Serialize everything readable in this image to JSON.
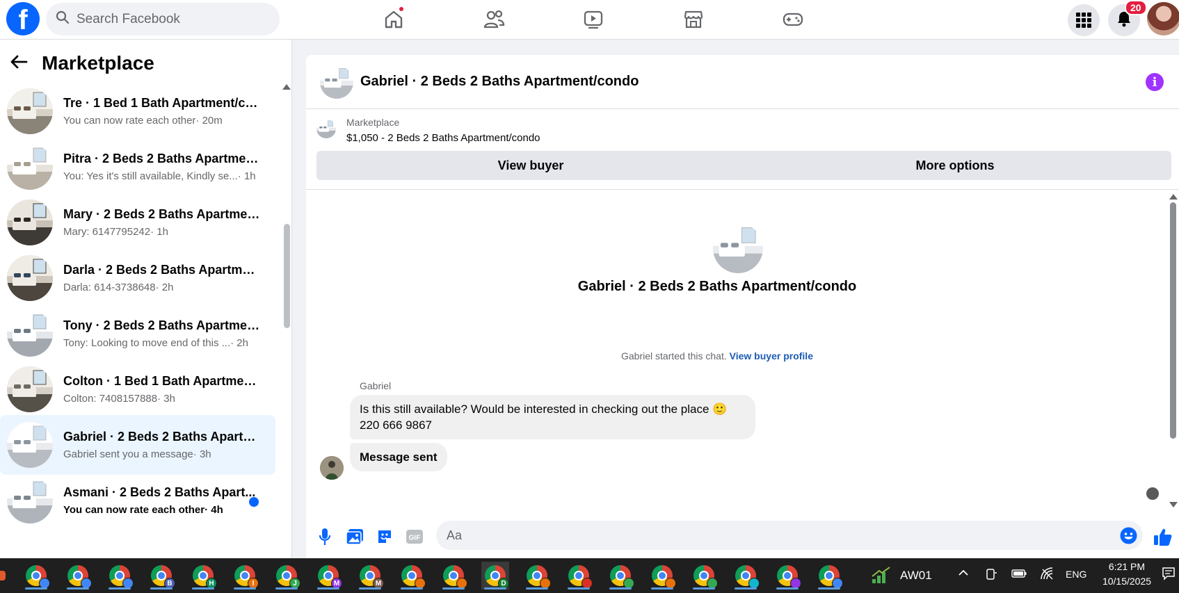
{
  "topbar": {
    "search_placeholder": "Search Facebook",
    "notification_count": "20",
    "icons": [
      "facebook-logo",
      "search-icon",
      "home-icon",
      "friends-icon",
      "video-icon",
      "marketplace-icon",
      "gaming-icon",
      "apps-grid-icon",
      "bell-icon",
      "profile-avatar"
    ]
  },
  "sidebar": {
    "title": "Marketplace",
    "conversations": [
      {
        "title": "Tre · 1 Bed 1 Bath Apartment/co...",
        "message": "You can now rate each other",
        "time": "· 20m",
        "unread": false,
        "selected": false
      },
      {
        "title": "Pitra · 2 Beds 2 Baths Apartment/...",
        "message": "You: Yes it's still available, Kindly se...",
        "time": " · 1h",
        "unread": false,
        "selected": false
      },
      {
        "title": "Mary · 2 Beds 2 Baths Apartmen...",
        "message": "Mary: 6147795242",
        "time": " · 1h",
        "unread": false,
        "selected": false
      },
      {
        "title": "Darla · 2 Beds 2 Baths Apartmen...",
        "message": "Darla: 614-3738648",
        "time": " · 2h",
        "unread": false,
        "selected": false
      },
      {
        "title": "Tony · 2 Beds 2 Baths Apartment...",
        "message": "Tony: Looking to move end of this ...",
        "time": " · 2h",
        "unread": false,
        "selected": false
      },
      {
        "title": "Colton · 1 Bed 1 Bath Apartment...",
        "message": "Colton: 7408157888",
        "time": " · 3h",
        "unread": false,
        "selected": false
      },
      {
        "title": "Gabriel · 2 Beds 2 Baths Apartm...",
        "message": "Gabriel sent you a message",
        "time": " · 3h",
        "unread": false,
        "selected": true
      },
      {
        "title": "Asmani · 2 Beds 2 Baths Apart...",
        "message": "You can now rate each other",
        "time": " · 4h",
        "unread": true,
        "selected": false
      }
    ]
  },
  "chat": {
    "header_title": "Gabriel · 2 Beds 2 Baths Apartment/condo",
    "listing_label": "Marketplace",
    "listing_price": "$1,050 - 2 Beds 2 Baths Apartment/condo",
    "view_buyer": "View buyer",
    "more_options": "More options",
    "center_title": "Gabriel · 2 Beds 2 Baths Apartment/condo",
    "started_text": "Gabriel started this chat.",
    "view_buyer_profile": "View buyer profile",
    "sender_name": "Gabriel",
    "message_line1": "Is this still available? Would be interested in checking out the place 🙂",
    "message_line2": "220 666 9867",
    "message_sent": "Message sent",
    "composer_placeholder": "Aa"
  },
  "taskbar": {
    "apps": [
      {
        "letter": "",
        "color": "#4285f4"
      },
      {
        "letter": "",
        "color": "#4285f4"
      },
      {
        "letter": "",
        "color": "#4285f4"
      },
      {
        "letter": "B",
        "color": "#4a5fb5"
      },
      {
        "letter": "H",
        "color": "#0a8f5f"
      },
      {
        "letter": "I",
        "color": "#e8710a"
      },
      {
        "letter": "J",
        "color": "#34a853"
      },
      {
        "letter": "M",
        "color": "#9334e6"
      },
      {
        "letter": "M",
        "color": "#7d5a50"
      },
      {
        "letter": "",
        "color": "#e8710a"
      },
      {
        "letter": "",
        "color": "#e8710a"
      },
      {
        "letter": "D",
        "color": "#188038"
      },
      {
        "letter": "",
        "color": "#e8710a"
      },
      {
        "letter": "",
        "color": "#d93025"
      },
      {
        "letter": "",
        "color": "#34a853"
      },
      {
        "letter": "",
        "color": "#e8710a"
      },
      {
        "letter": "",
        "color": "#34a853"
      },
      {
        "letter": "",
        "color": "#12b5cb"
      },
      {
        "letter": "",
        "color": "#9334e6"
      },
      {
        "letter": "",
        "color": "#4285f4"
      }
    ],
    "pinned_label": "AW01",
    "language": "ENG",
    "time": "6:21 PM",
    "date": "10/15/2025"
  }
}
